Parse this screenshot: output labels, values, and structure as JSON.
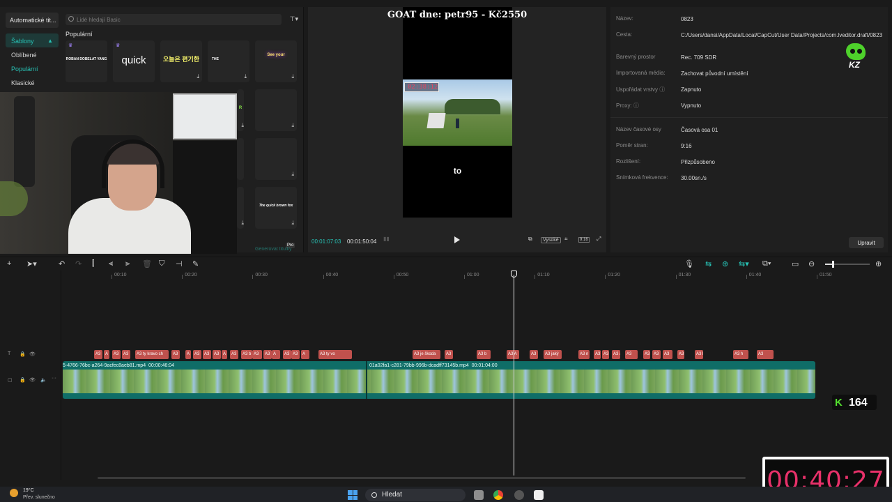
{
  "left_panel": {
    "top_tab": "Automatické tit...",
    "nav": [
      {
        "label": "Šablony",
        "active": true
      },
      {
        "label": "Oblíbené"
      },
      {
        "label": "Populární",
        "teal": true
      },
      {
        "label": "Klasické"
      }
    ],
    "search_placeholder": "Lidé hledají Basic",
    "filter_icon": "filter-icon",
    "section_title": "Populární",
    "templates": [
      {
        "text": "ROBAN DOBELAT YANG"
      },
      {
        "text": "quick"
      },
      {
        "text": "오늘은 편기한"
      },
      {
        "text": "THE"
      },
      {
        "text": "See your"
      },
      {
        "text": "R"
      },
      {
        "text": ""
      },
      {
        "text": "The quick brown fox"
      }
    ],
    "pro_badge": "Pro",
    "generate_label": "Generovat titulky"
  },
  "player": {
    "title": "GOAT dne: petr95 - Kč2550",
    "video_timer": "02:38:12",
    "caption": "to",
    "current_time": "00:01:07:03",
    "total_time": "00:01:50:04",
    "quality": "Vysoké",
    "ratio": "9:16"
  },
  "properties": {
    "rows": [
      {
        "key": "Název:",
        "value": "0823"
      },
      {
        "key": "Cesta:",
        "value": "C:/Users/dansi/AppData/Local/CapCut/User Data/Projects/com.lveditor.draft/0823"
      },
      {
        "key": "Barevný prostor",
        "value": "Rec. 709 SDR"
      },
      {
        "key": "Importovaná média:",
        "value": "Zachovat původní umístění"
      },
      {
        "key": "Uspořádat vrstvy ⓘ",
        "value": "Zapnuto"
      },
      {
        "key": "Proxy: ⓘ",
        "value": "Vypnuto"
      },
      {
        "key": "Název časové osy",
        "value": "Časová osa 01"
      },
      {
        "key": "Poměr stran:",
        "value": "9:16"
      },
      {
        "key": "Rozlišení:",
        "value": "Přizpůsobeno"
      },
      {
        "key": "Snímková frekvence:",
        "value": "30.00sn./s"
      }
    ],
    "edit_button": "Upravit",
    "logo_text": "KZ"
  },
  "timeline": {
    "ruler": [
      "00:10",
      "00:20",
      "00:30",
      "00:40",
      "00:50",
      "01:00",
      "01:10",
      "01:20",
      "01:30",
      "01:40",
      "01:50"
    ],
    "text_clips": [
      {
        "label": "A3"
      },
      {
        "label": "A"
      },
      {
        "label": "A3"
      },
      {
        "label": "A3"
      },
      {
        "label": "A3 ty kravo ch"
      },
      {
        "label": "A3"
      },
      {
        "label": "A"
      },
      {
        "label": "A3"
      },
      {
        "label": "A3"
      },
      {
        "label": "A3"
      },
      {
        "label": "A"
      },
      {
        "label": "A3"
      },
      {
        "label": "A3 b"
      },
      {
        "label": "A3"
      },
      {
        "label": "A3"
      },
      {
        "label": "A"
      },
      {
        "label": "A3"
      },
      {
        "label": "A3"
      },
      {
        "label": "A"
      },
      {
        "label": "A3 ty vo"
      },
      {
        "label": "A3 je škoda"
      },
      {
        "label": "A3"
      },
      {
        "label": "A3 b"
      },
      {
        "label": "A3 A"
      },
      {
        "label": "A3"
      },
      {
        "label": "A3 jaký"
      },
      {
        "label": "A3 n"
      },
      {
        "label": "A3"
      },
      {
        "label": "A3"
      },
      {
        "label": "A3 a"
      },
      {
        "label": "A3"
      },
      {
        "label": "A3"
      },
      {
        "label": "A3"
      },
      {
        "label": "A3"
      },
      {
        "label": "A3"
      },
      {
        "label": "A3 ke"
      },
      {
        "label": "A3 h"
      },
      {
        "label": "A3"
      }
    ],
    "video_clips": [
      {
        "name": "5-4766-76bc-a264-9acfec8aeb81.mp4",
        "duration": "00:00:46:04"
      },
      {
        "name": "01a02fa1-c281-79bb-996b-dcadff73145b.mp4",
        "duration": "00:01:04:00"
      }
    ]
  },
  "overlays": {
    "k_count": "164",
    "stream_timer": "00:40:27"
  },
  "taskbar": {
    "temp": "19°C",
    "weather": "Přev. slunečno",
    "search": "Hledat"
  },
  "colors": {
    "accent": "#27c2b5",
    "text_clip": "#c0514d",
    "video_track": "#0f6d67",
    "timer": "#e8316a"
  }
}
